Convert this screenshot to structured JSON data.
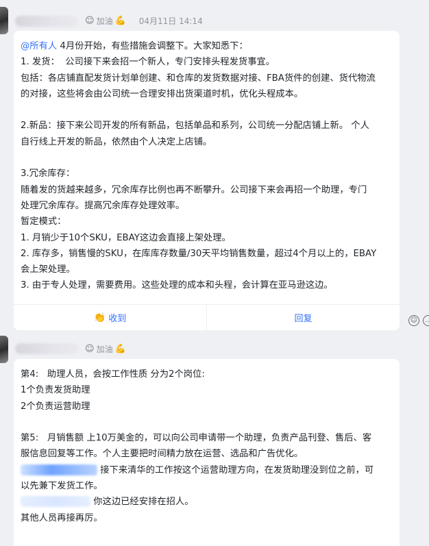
{
  "msg1": {
    "reaction_label": "加油",
    "timestamp": "04月11日 14:14",
    "mention": "@所有人",
    "first_line_rest": " 4月份开始，有些措施会调整下。大家知悉下：",
    "lines": [
      "1. 发货：  公司接下来会招一个新人，专门安排头程发货事宜。",
      "包括：各店铺直配发货计划单创建、和仓库的发货数据对接、FBA货件的创建、货代物流",
      "的对接，这些将会由公司统一合理安排出货渠道时机，优化头程成本。",
      "",
      "2.新品：接下来公司开发的所有新品，包括单品和系列，公司统一分配店铺上新。 个人",
      "自行线上开发的新品，依然由个人决定上店铺。",
      "",
      "3.冗余库存：",
      "随着发的货越来越多，冗余库存比例也再不断攀升。公司接下来会再招一个助理，专门",
      "处理冗余库存。提高冗余库存处理效率。",
      "暂定模式：",
      "1. 月销少于10个SKU，EBAY这边会直接上架处理。",
      "2. 库存多，销售慢的SKU，在库库存数量/30天平均销售数量，超过4个月以上的，EBAY",
      "会上架处理。",
      "3. 由于专人处理，需要费用。这些处理的成本和头程，会计算在亚马逊这边。"
    ],
    "actions": {
      "received": "收到",
      "reply": "回复"
    }
  },
  "msg2": {
    "reaction_label": "加油",
    "lines_a": [
      "第4:   助理人员，会按工作性质 分为2个岗位:",
      "1个负责发货助理",
      "2个负责运营助理",
      "",
      "第5:   月销售额 上10万美金的，可以向公司申请带一个助理，负责产品刊登、售后、客",
      "服信息回复等工作。个人主要把时间精力放在运营、选品和广告优化。"
    ],
    "line_b_rest": " 接下来清华的工作按这个运营助理方向，在发货助理没到位之前，可",
    "line_c": "以先兼下发货工作。",
    "line_d_rest": " 你这边已经安排在招人。",
    "line_e": "其他人员再接再厉。"
  },
  "icons": {
    "reaction": "smile-face-icon",
    "muscle": "flexed-biceps-icon",
    "clap": "clapping-hands-icon",
    "side_a": "add-reaction-icon",
    "side_b": "comment-icon"
  },
  "colors": {
    "mention": "#3370ff",
    "action": "#3370ff",
    "background": "#eff0f3",
    "bubble": "#ffffff"
  }
}
